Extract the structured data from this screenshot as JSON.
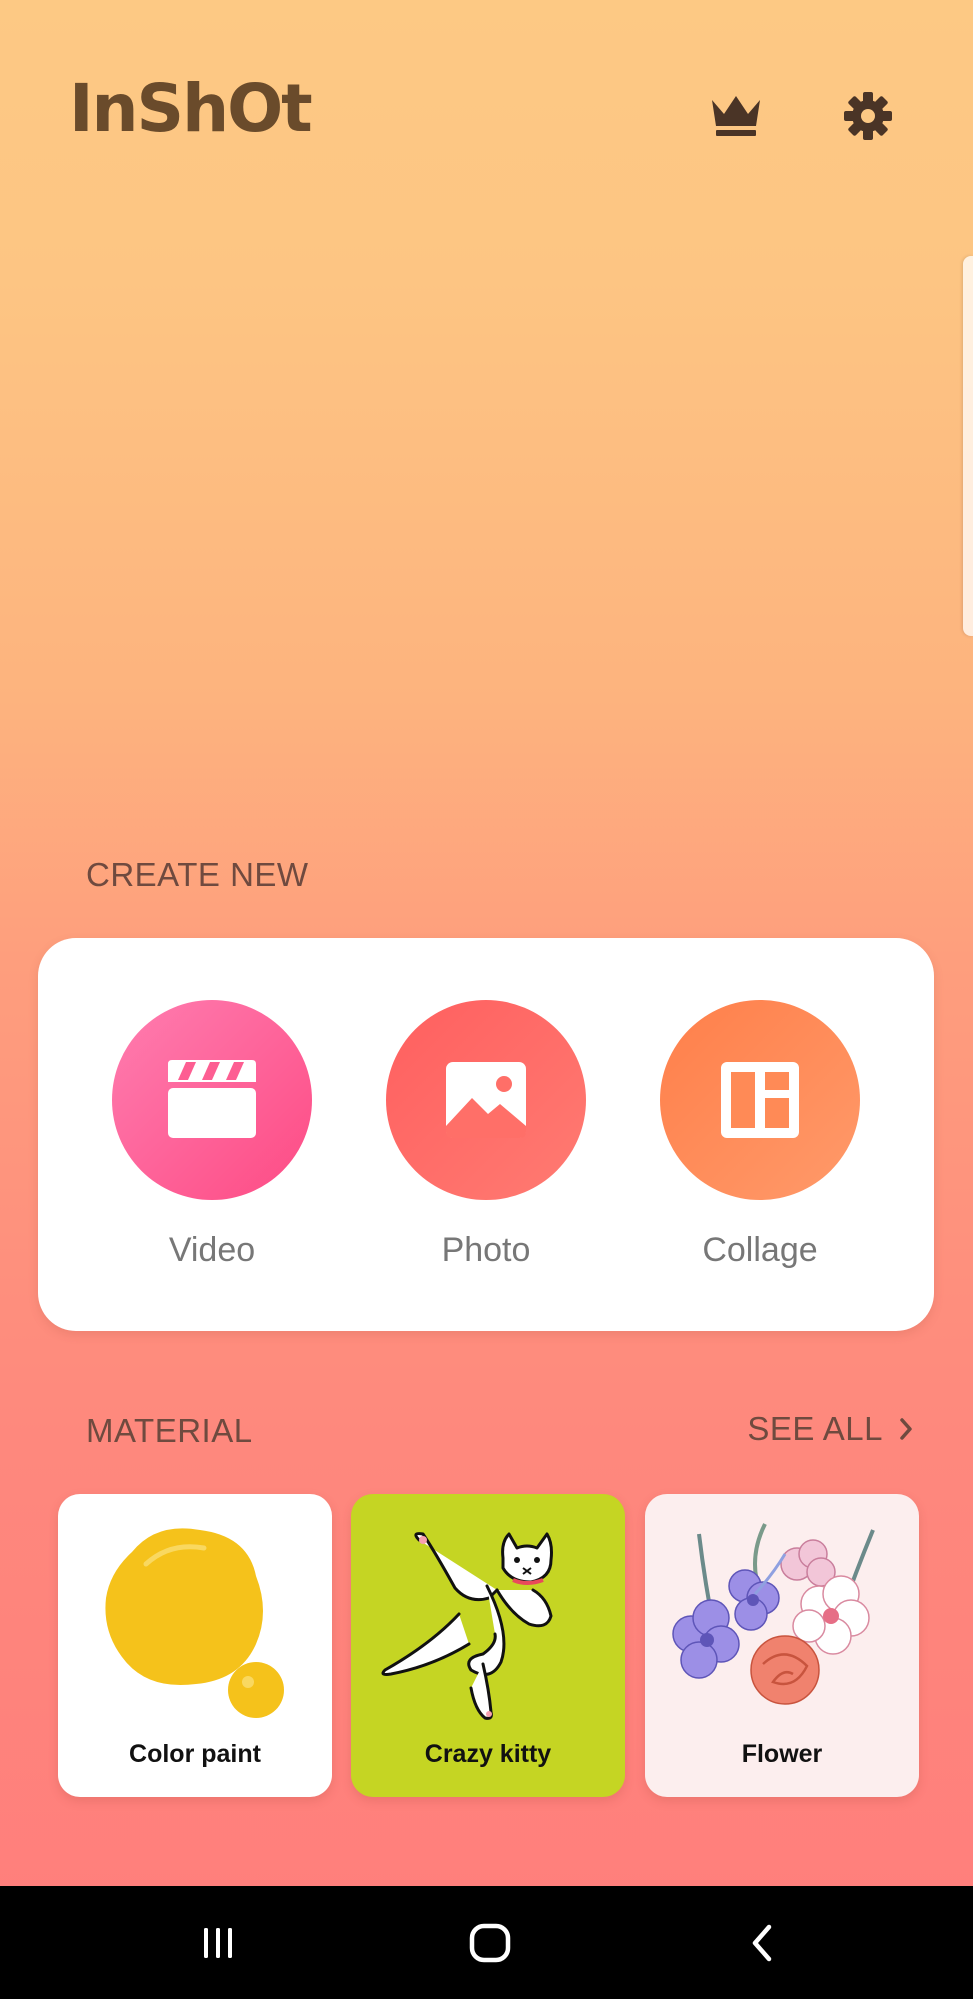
{
  "app": {
    "logo_text": "InShOt"
  },
  "header": {
    "icons": [
      "crown-icon",
      "gear-icon"
    ]
  },
  "create_new": {
    "section_label": "CREATE NEW",
    "items": [
      {
        "label": "Video",
        "icon": "clapperboard-icon",
        "color": "#FD5A8E"
      },
      {
        "label": "Photo",
        "icon": "image-icon",
        "color": "#FF6A66"
      },
      {
        "label": "Collage",
        "icon": "collage-layout-icon",
        "color": "#FF8B58"
      }
    ]
  },
  "material": {
    "section_label": "MATERIAL",
    "see_all_label": "SEE ALL",
    "items": [
      {
        "label": "Color paint",
        "bg_color": "#FFFFFF"
      },
      {
        "label": "Crazy kitty",
        "bg_color": "#C5D523"
      },
      {
        "label": "Flower",
        "bg_color": "#FCEEEE"
      }
    ]
  },
  "nav_bar": {
    "buttons": [
      "recents-icon",
      "home-icon",
      "back-icon"
    ]
  },
  "colors": {
    "background_top": "#FDC984",
    "background_bottom": "#FF7D7B",
    "section_text": "#6F4A3F",
    "logo": "#6A4B2B"
  }
}
